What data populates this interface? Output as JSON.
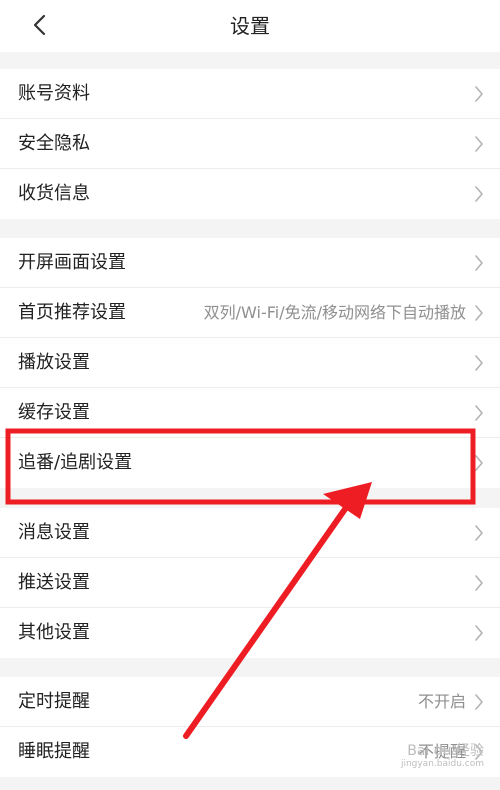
{
  "header": {
    "title": "设置"
  },
  "groups": [
    {
      "items": [
        {
          "label": "账号资料",
          "value": ""
        },
        {
          "label": "安全隐私",
          "value": ""
        },
        {
          "label": "收货信息",
          "value": ""
        }
      ]
    },
    {
      "items": [
        {
          "label": "开屏画面设置",
          "value": ""
        },
        {
          "label": "首页推荐设置",
          "value": "双列/Wi-Fi/免流/移动网络下自动播放"
        },
        {
          "label": "播放设置",
          "value": ""
        },
        {
          "label": "缓存设置",
          "value": ""
        },
        {
          "label": "追番/追剧设置",
          "value": ""
        }
      ]
    },
    {
      "items": [
        {
          "label": "消息设置",
          "value": ""
        },
        {
          "label": "推送设置",
          "value": ""
        },
        {
          "label": "其他设置",
          "value": ""
        }
      ]
    },
    {
      "items": [
        {
          "label": "定时提醒",
          "value": "不开启"
        },
        {
          "label": "睡眠提醒",
          "value": "不提醒"
        }
      ]
    }
  ],
  "annotation": {
    "color": "#ee1d24"
  },
  "watermark": {
    "brand": "Bai du 经验",
    "url": "jingyan.baidu.com"
  },
  "icons": {
    "back": "chevron-left-icon",
    "row": "chevron-right-icon"
  }
}
